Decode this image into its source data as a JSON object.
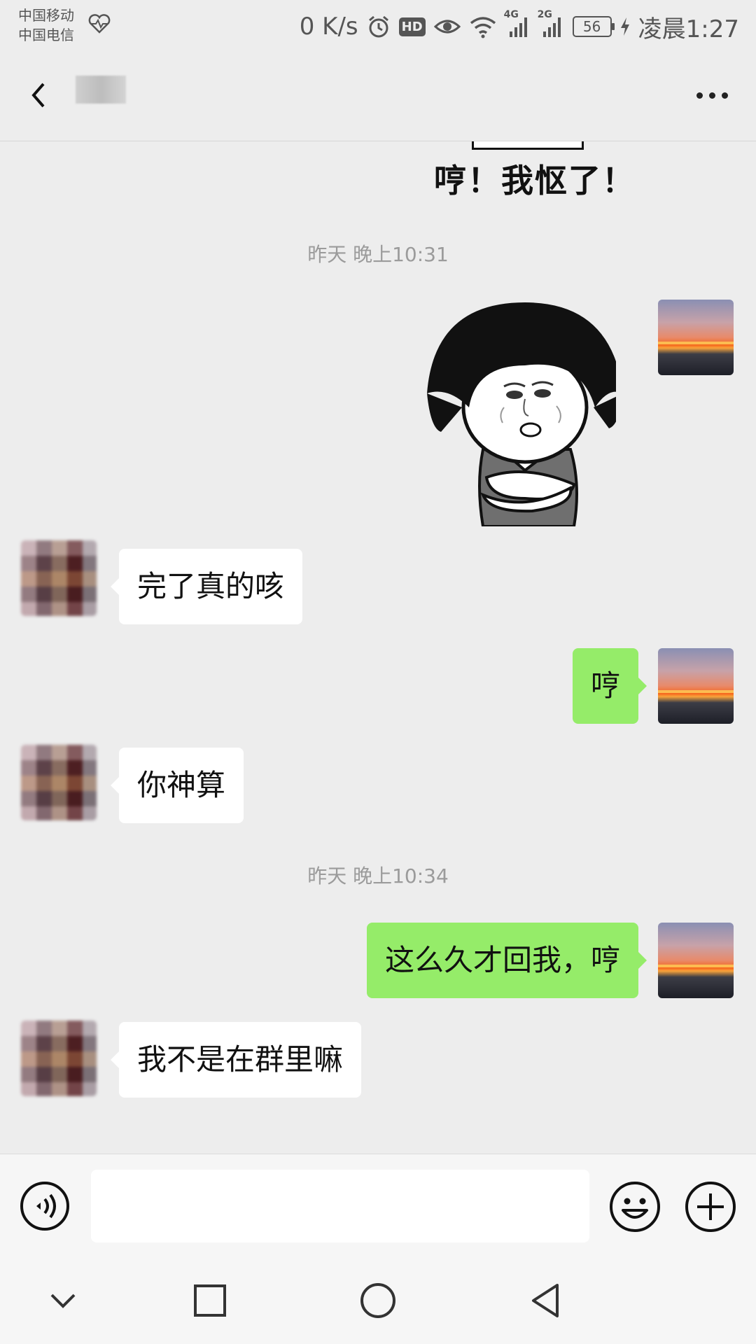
{
  "status_bar": {
    "carrier_1": "中国移动",
    "carrier_2": "中国电信",
    "net_speed": "0 K/s",
    "hd_badge": "HD",
    "signal_1_label": "4G",
    "signal_2_label": "2G",
    "battery": "56",
    "time": "凌晨1:27"
  },
  "header": {
    "icons": [
      "back-icon",
      "more-icon"
    ]
  },
  "messages": [
    {
      "type": "sticker_caption",
      "side": "other",
      "text": "哼！我怄了！"
    },
    {
      "type": "time",
      "text": "昨天 晚上10:31"
    },
    {
      "type": "sticker",
      "side": "me"
    },
    {
      "type": "text",
      "side": "other",
      "text": "完了真的咳"
    },
    {
      "type": "text",
      "side": "me",
      "text": "哼"
    },
    {
      "type": "text",
      "side": "other",
      "text": "你神算"
    },
    {
      "type": "time",
      "text": "昨天 晚上10:34"
    },
    {
      "type": "text",
      "side": "me",
      "text": "这么久才回我，哼"
    },
    {
      "type": "text",
      "side": "other",
      "text": "我不是在群里嘛"
    }
  ],
  "input_bar": {
    "text_value": "",
    "icons": [
      "voice-icon",
      "emoji-icon",
      "plus-icon"
    ]
  },
  "nav_bar": {
    "icons": [
      "hide-chevron-icon",
      "recents-square-icon",
      "home-circle-icon",
      "back-triangle-icon"
    ]
  },
  "colors": {
    "background": "#ededed",
    "out_bubble": "#95ec69",
    "in_bubble": "#ffffff",
    "timestamp": "#9b9b9b"
  }
}
